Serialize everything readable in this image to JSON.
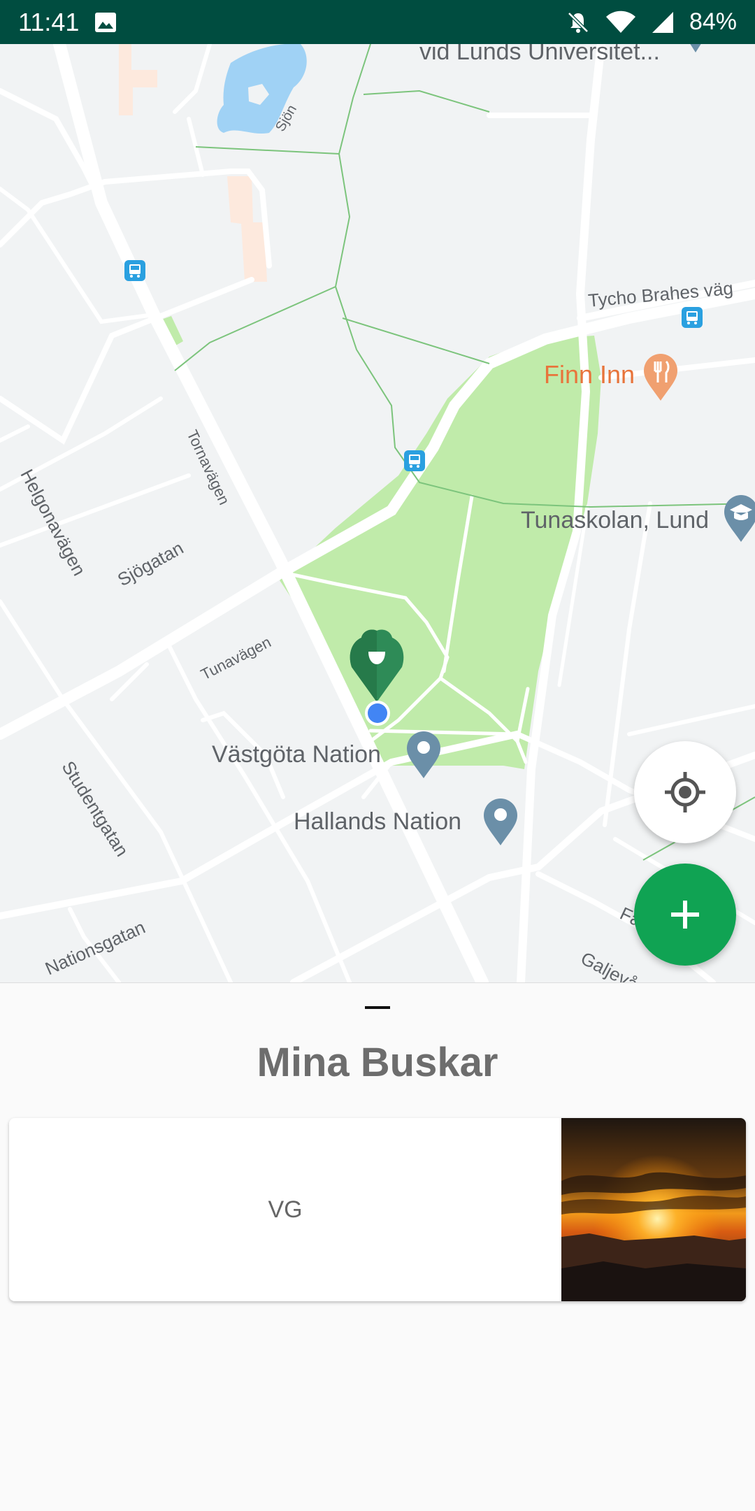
{
  "status_bar": {
    "time": "11:41",
    "battery": "84%",
    "icons": [
      "image-icon",
      "bell-off-icon",
      "wifi-icon",
      "signal-icon",
      "battery-icon"
    ]
  },
  "map": {
    "streets": {
      "tornavagen": "Tornavägen",
      "helgonavagen": "Helgonavägen",
      "sjogatan": "Sjögatan",
      "tunavagen": "Tunavägen",
      "studentgatan": "Studentgatan",
      "nationsgatan": "Nationsgatan",
      "tycho": "Tycho Brahes väg",
      "galjevang": "Galjevångsvägen",
      "sjon": "Sjön",
      "fal": "Fal"
    },
    "pois": {
      "lunds": "vid Lunds Universitet...",
      "finn_inn": "Finn Inn",
      "tunaskolan": "Tunaskolan, Lund",
      "vastgota": "Västgöta Nation",
      "hallands": "Hallands Nation"
    },
    "colors": {
      "park": "#c0ebaa",
      "marker": "#2e8b57",
      "accent": "#10a353",
      "location": "#4285f4"
    }
  },
  "sheet": {
    "title": "Mina Buskar",
    "cards": [
      {
        "label": "VG"
      }
    ]
  }
}
